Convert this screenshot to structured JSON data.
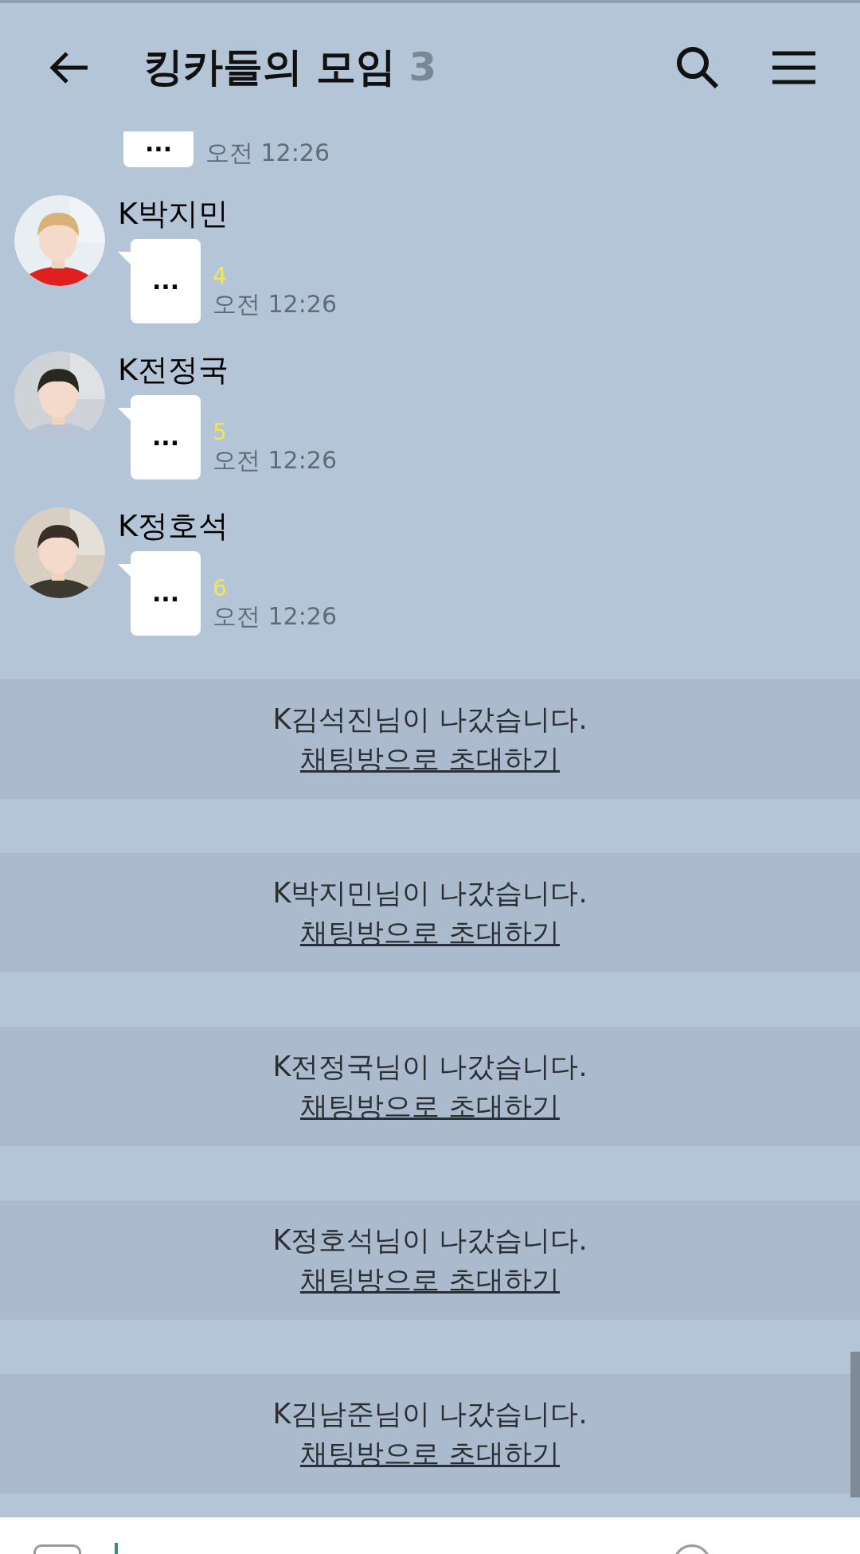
{
  "header": {
    "title": "킹카들의 모임",
    "member_count": "3"
  },
  "partial_message": {
    "text": "...",
    "time": "오전 12:26"
  },
  "messages": [
    {
      "name": "K박지민",
      "text": "...",
      "unread": "4",
      "time": "오전 12:26"
    },
    {
      "name": "K전정국",
      "text": "...",
      "unread": "5",
      "time": "오전 12:26"
    },
    {
      "name": "K정호석",
      "text": "...",
      "unread": "6",
      "time": "오전 12:26"
    }
  ],
  "notices": [
    {
      "text": "K김석진님이 나갔습니다.",
      "link": "채팅방으로 초대하기"
    },
    {
      "text": "K박지민님이 나갔습니다.",
      "link": "채팅방으로 초대하기"
    },
    {
      "text": "K전정국님이 나갔습니다.",
      "link": "채팅방으로 초대하기"
    },
    {
      "text": "K정호석님이 나갔습니다.",
      "link": "채팅방으로 초대하기"
    },
    {
      "text": "K김남준님이 나갔습니다.",
      "link": "채팅방으로 초대하기"
    }
  ]
}
